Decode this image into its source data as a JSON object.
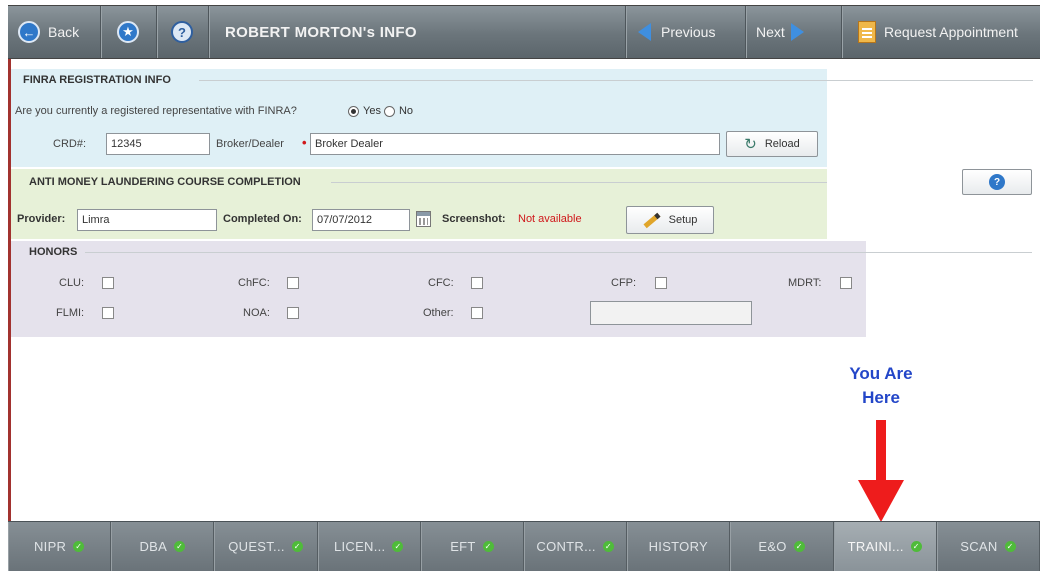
{
  "toolbar": {
    "back_label": "Back",
    "title": "ROBERT MORTON's INFO",
    "previous_label": "Previous",
    "next_label": "Next",
    "request_label": "Request Appointment"
  },
  "finra": {
    "legend": "FINRA REGISTRATION INFO",
    "question": "Are you currently a registered representative with FINRA?",
    "yes_label": "Yes",
    "no_label": "No",
    "selected": "Yes",
    "crd_label": "CRD#:",
    "crd_value": "12345",
    "bd_label": "Broker/Dealer",
    "bd_value": "Broker Dealer",
    "reload_label": "Reload"
  },
  "aml": {
    "legend": "ANTI MONEY LAUNDERING COURSE COMPLETION",
    "provider_label": "Provider:",
    "provider_value": "Limra",
    "completed_label": "Completed On:",
    "completed_value": "07/07/2012",
    "screenshot_label": "Screenshot:",
    "screenshot_value": "Not available",
    "setup_label": "Setup"
  },
  "honors": {
    "legend": "HONORS",
    "row1": [
      "CLU:",
      "ChFC:",
      "CFC:",
      "CFP:",
      "MDRT:"
    ],
    "row2": [
      "FLMI:",
      "NOA:",
      "Other:"
    ]
  },
  "annotation": {
    "line1": "You Are",
    "line2": "Here"
  },
  "tabs": [
    {
      "label": "NIPR",
      "check": true
    },
    {
      "label": "DBA",
      "check": true
    },
    {
      "label": "QUEST...",
      "check": true
    },
    {
      "label": "LICEN...",
      "check": true
    },
    {
      "label": "EFT",
      "check": true
    },
    {
      "label": "CONTR...",
      "check": true
    },
    {
      "label": "HISTORY",
      "check": false
    },
    {
      "label": "E&O",
      "check": true
    },
    {
      "label": "TRAINI...",
      "check": true,
      "active": true
    },
    {
      "label": "SCAN",
      "check": true
    }
  ],
  "colors": {
    "finra_bg": "#dff0f6",
    "aml_bg": "#e7f1d8",
    "honors_bg": "#e5e2ec",
    "accent": "#2f78c9",
    "required": "#d0181b",
    "not_available": "#d0181b",
    "annotation_text": "#2346c8",
    "annotation_arrow": "#ee1c1c"
  }
}
